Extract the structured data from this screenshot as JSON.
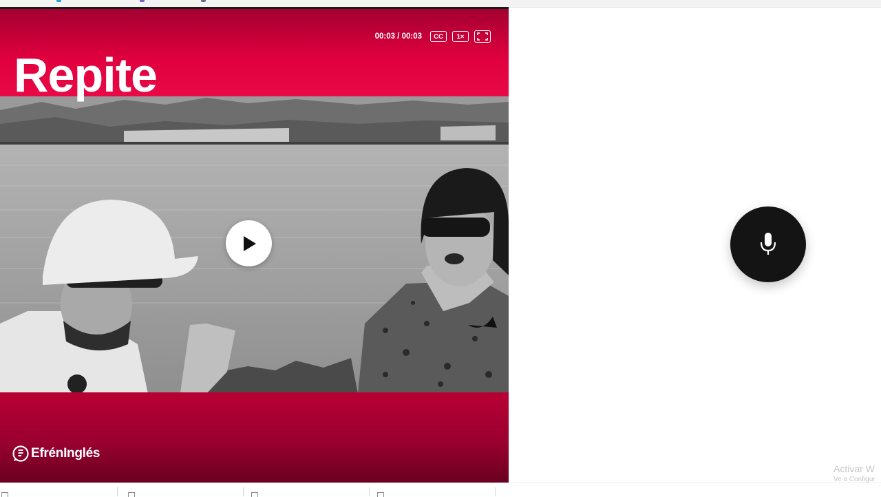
{
  "video": {
    "title": "Repite",
    "time": "00:03 / 00:03",
    "cc_label": "CC",
    "speed_label": "1×",
    "brand_name": "EfrénInglés"
  },
  "colors": {
    "brand": "#e0003f",
    "mic_button": "#141414"
  },
  "watermark": {
    "line1": "Activar W",
    "line2": "Ve a Configur"
  }
}
